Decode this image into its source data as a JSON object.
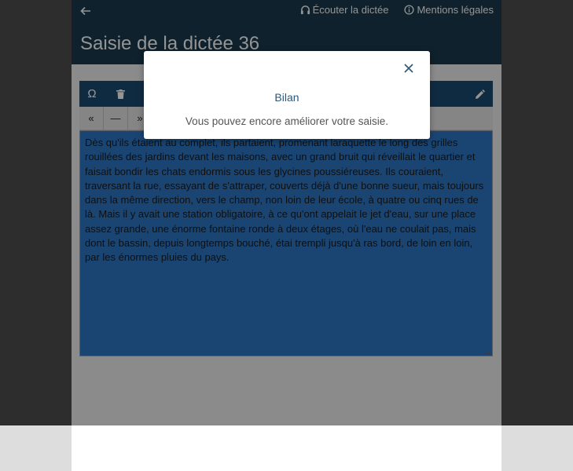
{
  "header": {
    "title": "Saisie de la dictée 36",
    "nav": [
      {
        "label": "Écouter la dictée",
        "icon": "headphones-icon"
      },
      {
        "label": "Mentions légales",
        "icon": "info-circle-icon"
      }
    ],
    "back_icon": "arrow-left-icon"
  },
  "editor": {
    "toolbar_icons": [
      "omega-icon",
      "trash-icon",
      "pencil-icon"
    ],
    "special_chars": [
      "«",
      "—",
      "»"
    ],
    "text": "Dès qu'ils étaient au complet, ils partaient, promenant laraquette le long des grilles rouillées des jardins devant les maisons, avec un grand bruit qui réveillait le quartier et faisait bondir les chats endormis sous les glycines poussiéreuses. Ils couraient, traversant la rue, essayant de s'attraper, couverts déjà d'une bonne sueur, mais toujours dans la même direction, vers le champ, non loin de leur école, à quatre ou cinq rues de là. Mais il y avait une station obligatoire, à ce qu'ont appelait le jet d'eau, sur une place assez grande, une énorme fontaine ronde à deux étages, où l'eau ne coulait pas, mais dont le bassin, depuis longtemps bouché, étai trempli jusqu'à ras bord, de loin en loin, par les énormes pluies du pays."
  },
  "modal": {
    "title": "Bilan",
    "message": "Vous pouvez encore améliorer votre saisie.",
    "close_icon": "close-icon"
  },
  "colors": {
    "header_bg": "#1b3a4c",
    "toolbar_bg": "#1b4b73",
    "textarea_bg": "#2e78c4",
    "accent": "#2a5877"
  }
}
